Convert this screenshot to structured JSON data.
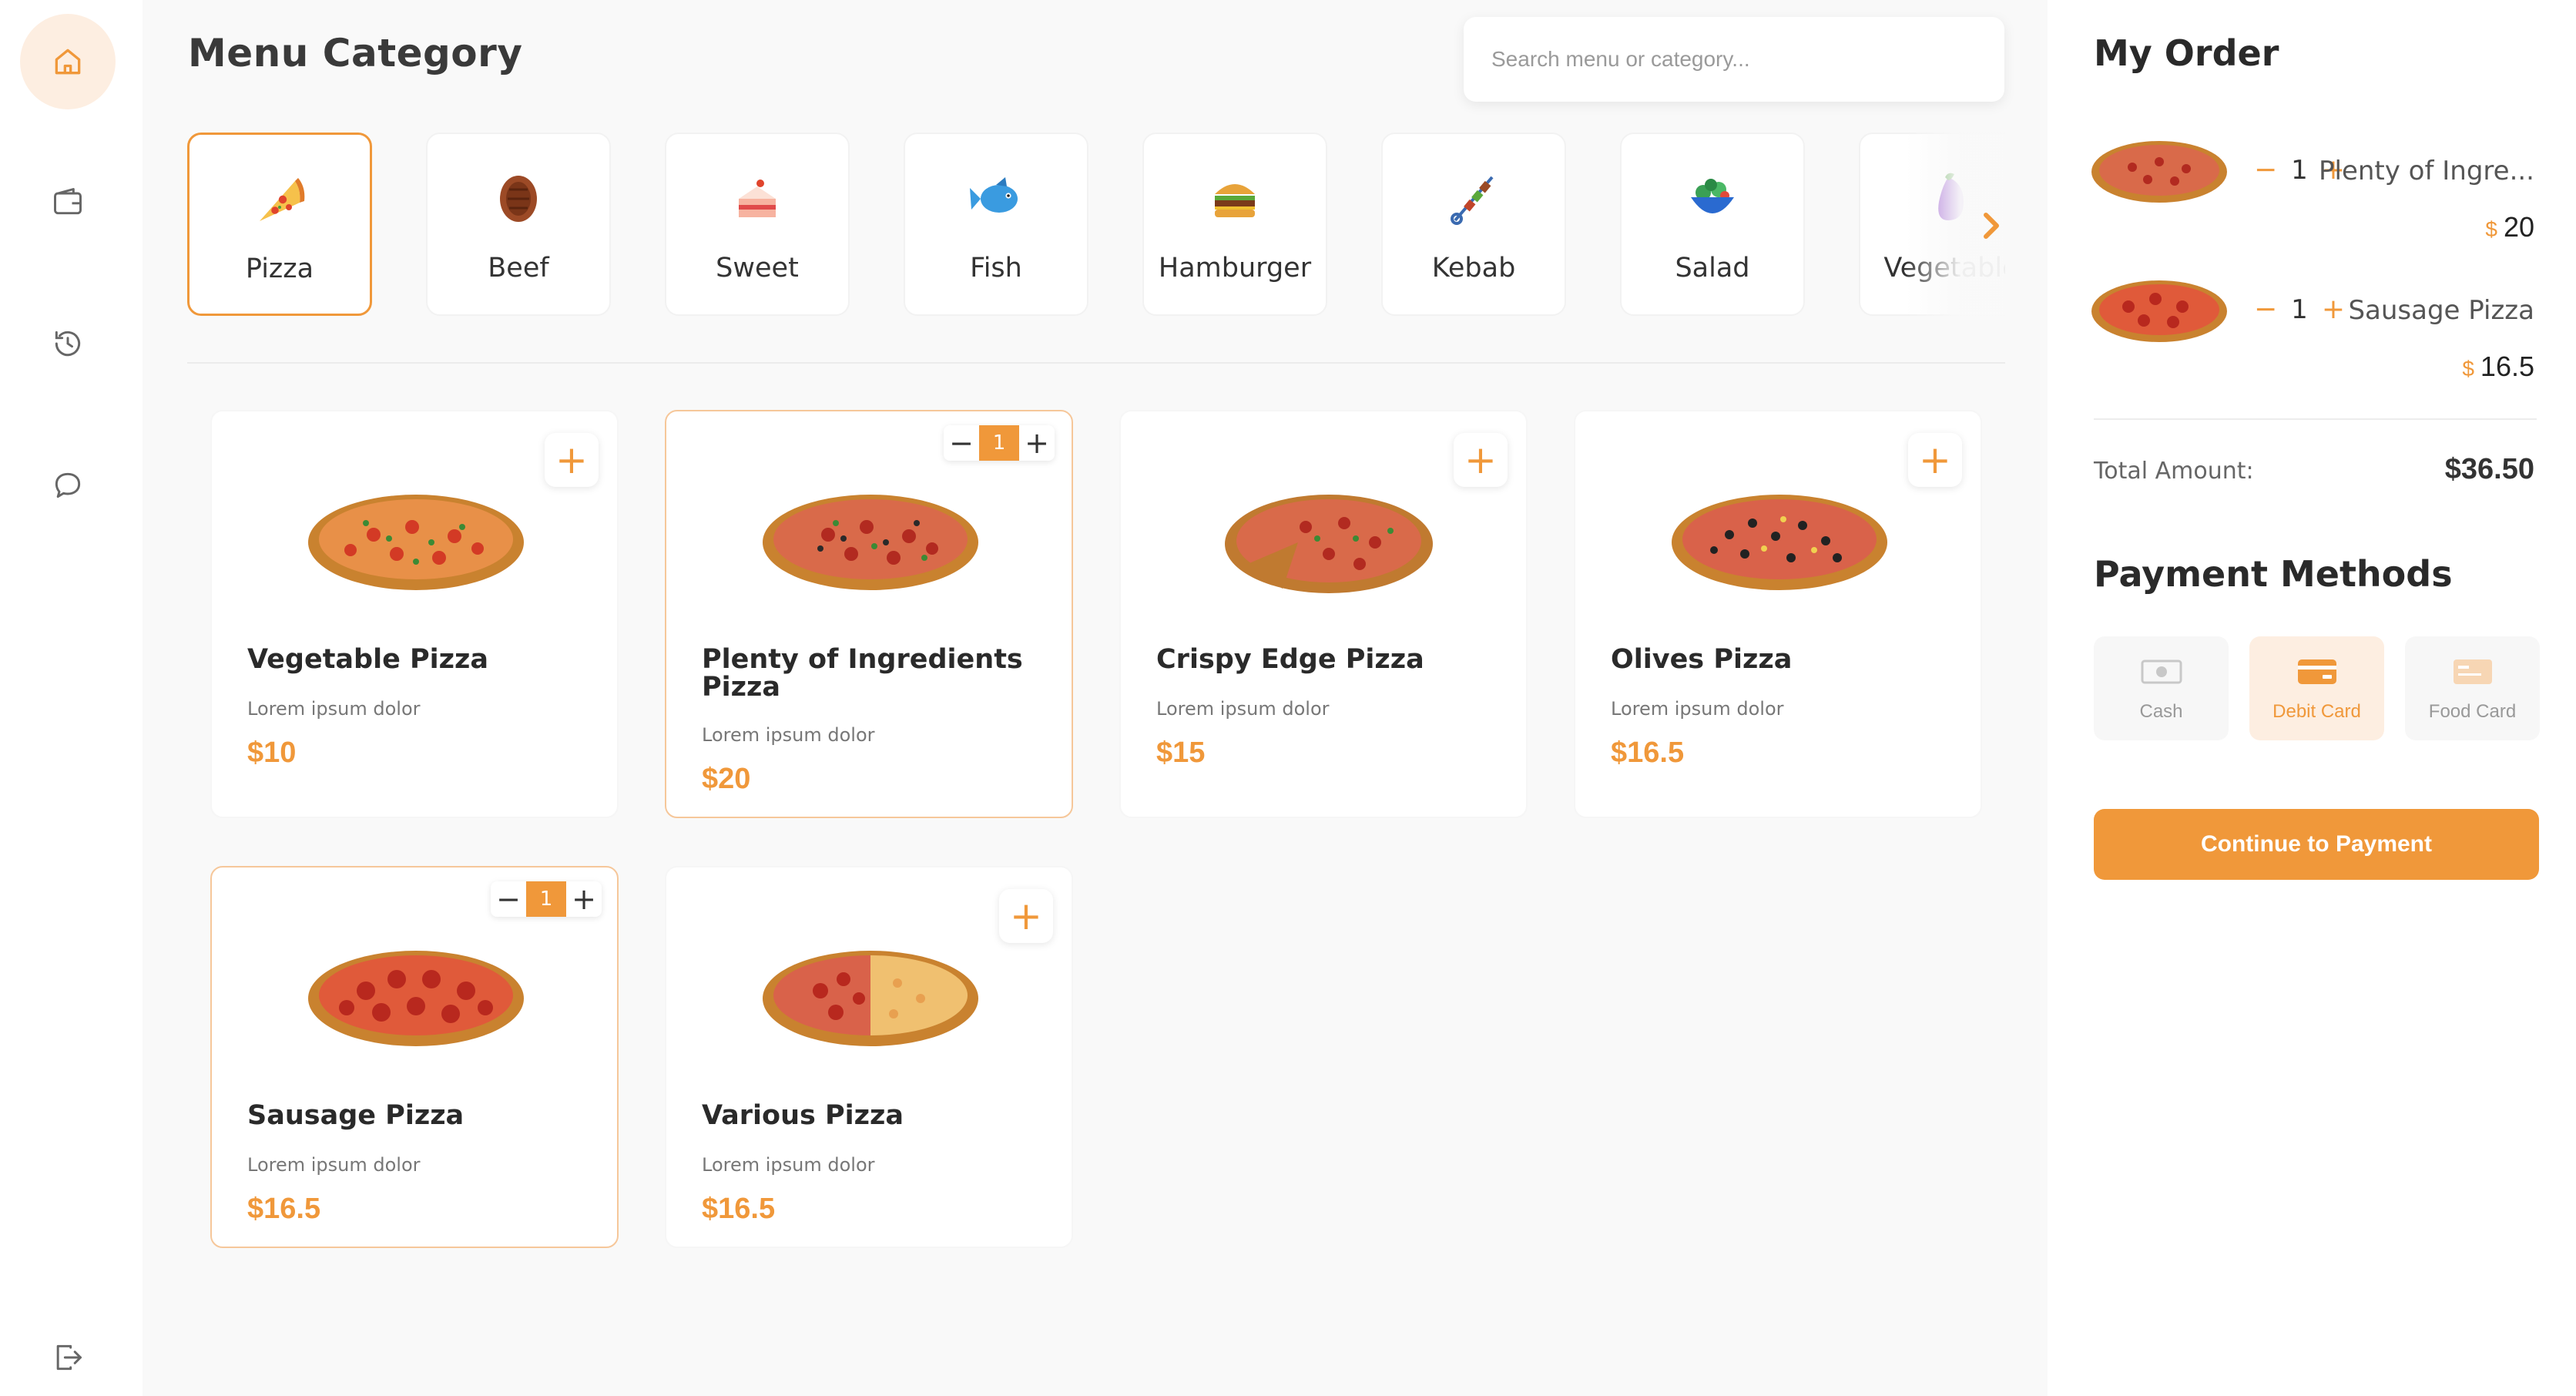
{
  "sidebar": {
    "items": [
      {
        "icon": "home-icon"
      },
      {
        "icon": "wallet-icon"
      },
      {
        "icon": "history-icon"
      },
      {
        "icon": "chat-icon"
      }
    ],
    "logout_icon": "logout-icon"
  },
  "main": {
    "title": "Menu Category",
    "search_placeholder": "Search menu or category..."
  },
  "categories": [
    {
      "label": "Pizza",
      "icon": "pizza-icon",
      "active": true
    },
    {
      "label": "Beef",
      "icon": "beef-icon"
    },
    {
      "label": "Sweet",
      "icon": "cake-icon"
    },
    {
      "label": "Fish",
      "icon": "fish-icon"
    },
    {
      "label": "Hamburger",
      "icon": "hamburger-icon"
    },
    {
      "label": "Kebab",
      "icon": "kebab-icon"
    },
    {
      "label": "Salad",
      "icon": "salad-icon"
    },
    {
      "label": "Vegetable",
      "icon": "vegetable-icon"
    }
  ],
  "products": [
    {
      "name": "Vegetable Pizza",
      "desc": "Lorem ipsum dolor",
      "price": "$10"
    },
    {
      "name": "Plenty of Ingredients Pizza",
      "desc": "Lorem ipsum dolor",
      "price": "$20",
      "qty": "1"
    },
    {
      "name": "Crispy Edge Pizza",
      "desc": "Lorem ipsum dolor",
      "price": "$15"
    },
    {
      "name": "Olives Pizza",
      "desc": "Lorem ipsum dolor",
      "price": "$16.5"
    },
    {
      "name": "Sausage Pizza",
      "desc": "Lorem ipsum dolor",
      "price": "$16.5",
      "qty": "1"
    },
    {
      "name": "Various Pizza",
      "desc": "Lorem ipsum dolor",
      "price": "$16.5"
    }
  ],
  "order": {
    "title": "My Order",
    "items": [
      {
        "qty": "1",
        "name": "Plenty of Ingre...",
        "currency": "$",
        "price": "20"
      },
      {
        "qty": "1",
        "name": "Sausage Pizza",
        "currency": "$",
        "price": "16.5"
      }
    ],
    "total_label": "Total Amount:",
    "total_value": "$36.50",
    "payment_title": "Payment Methods",
    "payment_methods": [
      {
        "label": "Cash",
        "icon": "cash-icon"
      },
      {
        "label": "Debit Card",
        "icon": "debit-card-icon",
        "active": true
      },
      {
        "label": "Food Card",
        "icon": "food-card-icon"
      }
    ],
    "continue_label": "Continue to Payment"
  },
  "colors": {
    "accent": "#f0983a",
    "accent_light": "#fdeee1"
  }
}
